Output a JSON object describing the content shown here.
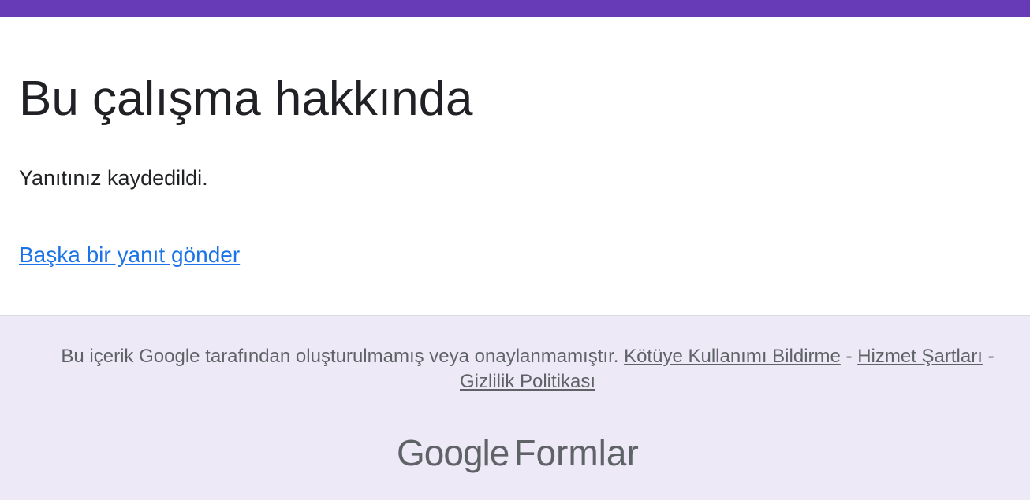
{
  "form": {
    "title": "Bu çalışma hakkında",
    "confirmation_message": "Yanıtınız kaydedildi.",
    "submit_another_label": "Başka bir yanıt gönder"
  },
  "footer": {
    "disclaimer_text": "Bu içerik Google tarafından oluşturulmamış veya onaylanmamıştır.",
    "report_abuse_label": "Kötüye Kullanımı Bildirme",
    "separator": "-",
    "terms_label": "Hizmet Şartları",
    "privacy_label": "Gizlilik Politikası",
    "brand_google": "Google",
    "brand_product": "Formlar"
  },
  "colors": {
    "accent": "#673ab7",
    "link": "#1a73e8",
    "footer_bg": "#ede9f6"
  }
}
